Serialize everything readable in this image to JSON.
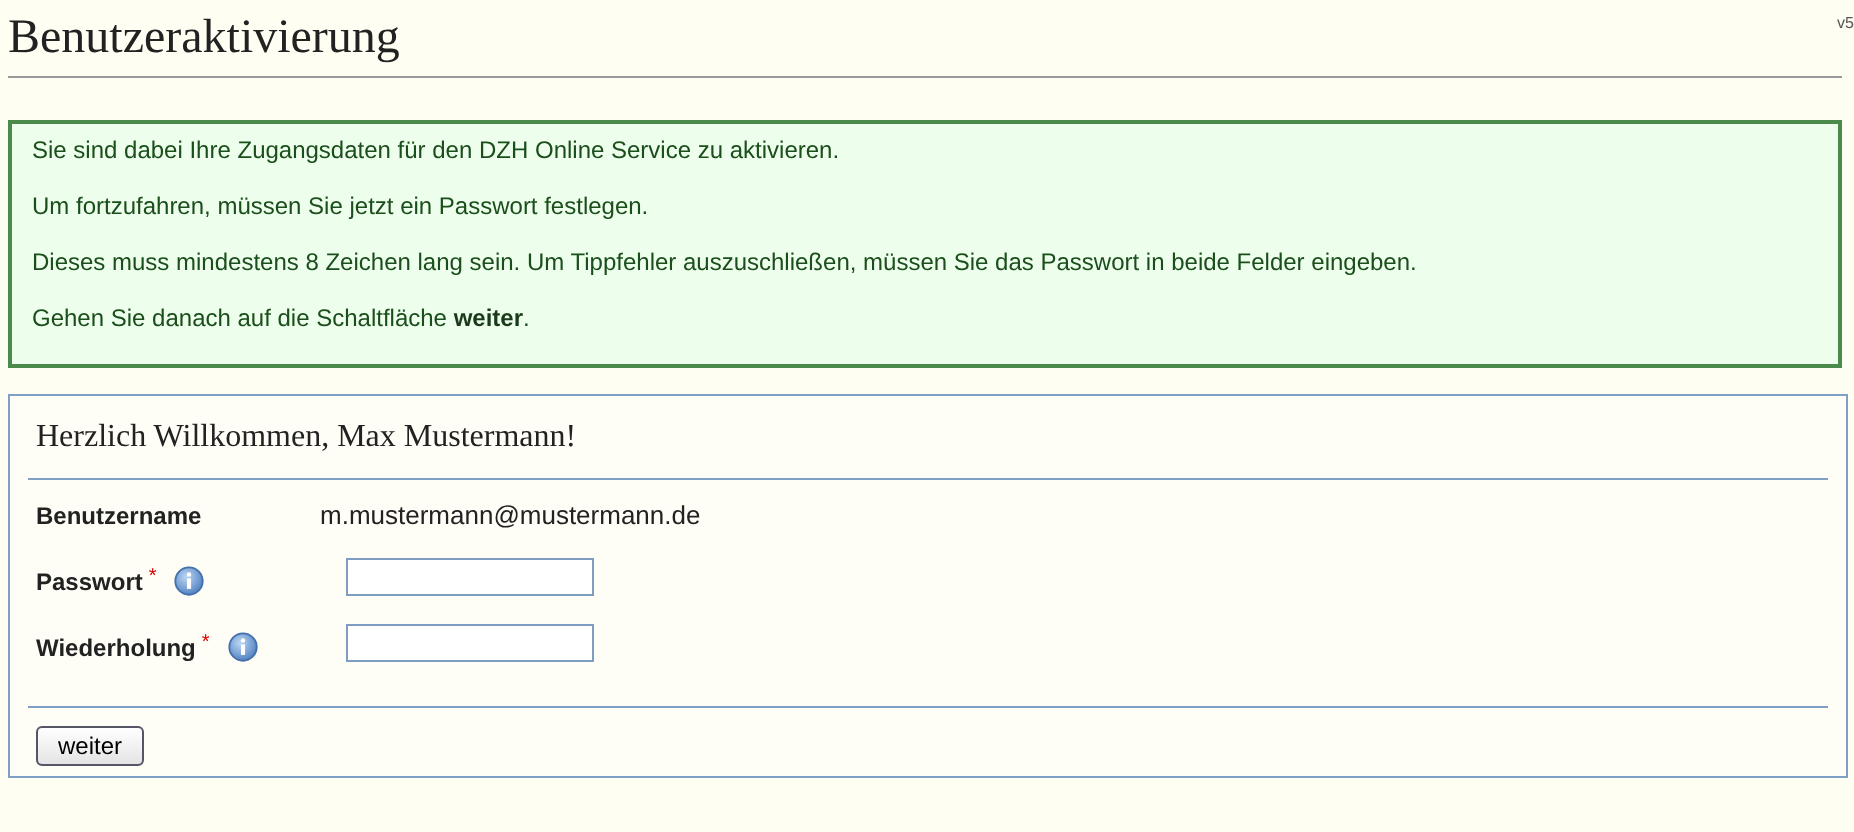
{
  "page": {
    "title": "Benutzeraktivierung",
    "version": "v5"
  },
  "notice": {
    "paragraphs": [
      "Sie sind dabei Ihre Zugangsdaten für den DZH Online Service zu aktivieren.",
      "Um fortzufahren, müssen Sie jetzt ein Passwort festlegen.",
      "Dieses muss mindestens 8 Zeichen lang sein. Um Tippfehler auszuschließen, müssen Sie das Passwort in beide Felder eingeben.",
      "Gehen Sie danach auf die Schaltfläche **weiter**."
    ]
  },
  "form": {
    "heading": "Herzlich Willkommen, Max Mustermann!",
    "fields": [
      {
        "kind": "text",
        "label": "Benutzername",
        "value": "m.mustermann@mustermann.de",
        "required": false,
        "info": false
      },
      {
        "kind": "password",
        "label": "Passwort",
        "required_mark": "*",
        "required": true,
        "info": true
      },
      {
        "kind": "password",
        "label": "Wiederholung",
        "required_mark": "*",
        "required": true,
        "info": true
      }
    ],
    "buttons": [
      "weiter"
    ]
  }
}
